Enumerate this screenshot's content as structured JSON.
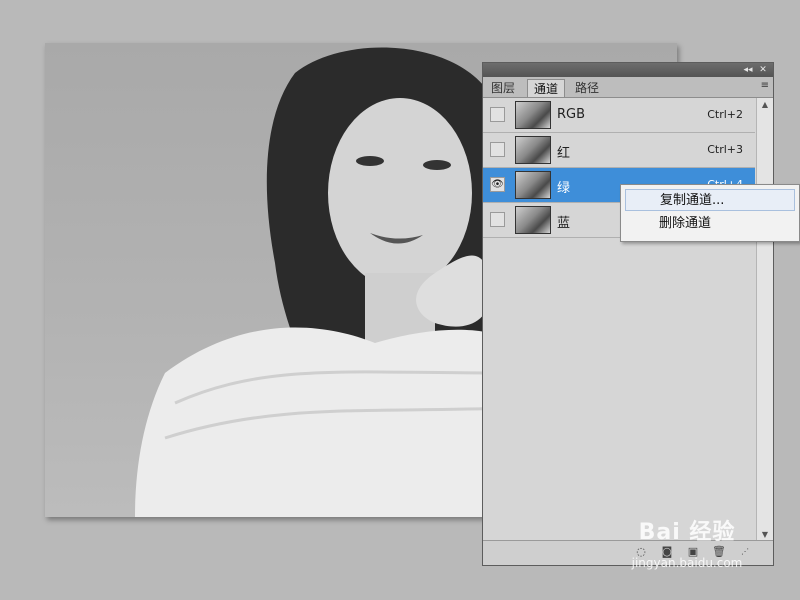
{
  "canvas": {
    "image_desc_icon": "photo-icon"
  },
  "panel": {
    "tabs": [
      {
        "label": "图层"
      },
      {
        "label": "通道"
      },
      {
        "label": "路径"
      }
    ],
    "active_tab": "通道",
    "title_buttons": {
      "collapse": "◂◂",
      "close": "✕"
    },
    "menu_icon": "≡",
    "channels": [
      {
        "label": "RGB",
        "shortcut": "Ctrl+2",
        "visible": false,
        "selected": false
      },
      {
        "label": "红",
        "shortcut": "Ctrl+3",
        "visible": false,
        "selected": false
      },
      {
        "label": "绿",
        "shortcut": "Ctrl+4",
        "visible": true,
        "selected": true
      },
      {
        "label": "蓝",
        "shortcut": "",
        "visible": false,
        "selected": false
      }
    ]
  },
  "context_menu": {
    "items": [
      {
        "label": "复制通道..."
      },
      {
        "label": "删除通道"
      }
    ]
  },
  "watermark": {
    "logo": "Bai 经验",
    "url": "jingyan.baidu.com"
  },
  "colors": {
    "selection": "#3e8ed9",
    "panel_bg": "#d6d6d6",
    "app_bg": "#b9b9b9"
  }
}
